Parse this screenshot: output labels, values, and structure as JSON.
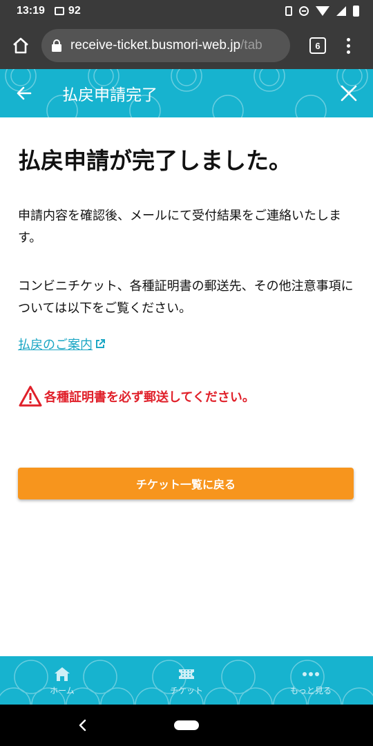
{
  "status_bar": {
    "time": "13:19",
    "notification_count": "92"
  },
  "browser": {
    "url_host": "receive-ticket.busmori-web.jp",
    "url_path": "/tab",
    "tab_count": "6"
  },
  "header": {
    "title": "払戻申請完了",
    "background_color": "#17b3cf"
  },
  "main": {
    "heading": "払戻申請が完了しました。",
    "paragraph1": "申請内容を確認後、メールにて受付結果をご連絡いたします。",
    "paragraph2": "コンビニチケット、各種証明書の郵送先、その他注意事項については以下をご覧ください。",
    "guide_link": "払戻のご案内",
    "warning": "各種証明書を必ず郵送してください。",
    "warning_color": "#e0202a",
    "back_button": "チケット一覧に戻る",
    "button_color": "#f7951d"
  },
  "tabbar": {
    "items": [
      {
        "label": "ホーム",
        "icon": "home-icon"
      },
      {
        "label": "チケット",
        "icon": "ticket-icon"
      },
      {
        "label": "もっと見る",
        "icon": "more-icon"
      }
    ]
  }
}
